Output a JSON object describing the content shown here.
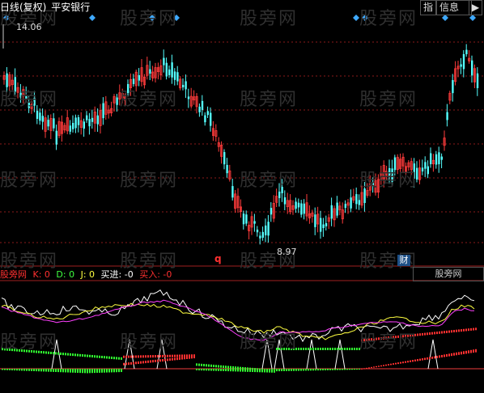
{
  "title_bar": {
    "period": "日线(复权)",
    "stock_name": "平安银行"
  },
  "toolbar": {
    "zhibiao_label": "指",
    "info_label": "信息",
    "scroll_arrow": "▶"
  },
  "price_panel": {
    "high_label": "14.06",
    "low_label": "8.97",
    "marker_q": "q",
    "cai_button": "财"
  },
  "watermark": "股旁网",
  "indicator": {
    "name": "股旁网",
    "k_label": "K: 0",
    "d_label": "D: 0",
    "j_label": "J: 0",
    "mj_label": "买进: -0",
    "mr_label": "买入: -0",
    "selector_label": "股旁网"
  },
  "colors": {
    "up": "#ff3b3b",
    "down": "#54ffff",
    "k_line": "#ffffff",
    "d_line": "#ffff40",
    "j_line": "#ff40ff",
    "green_bar": "#30ff30",
    "red_bar": "#ff3030",
    "grid": "#8b1a1a",
    "diamond": "#3fa9ff",
    "label_red": "#ff3030",
    "label_green": "#40ff40",
    "label_yellow": "#ffff40"
  }
}
